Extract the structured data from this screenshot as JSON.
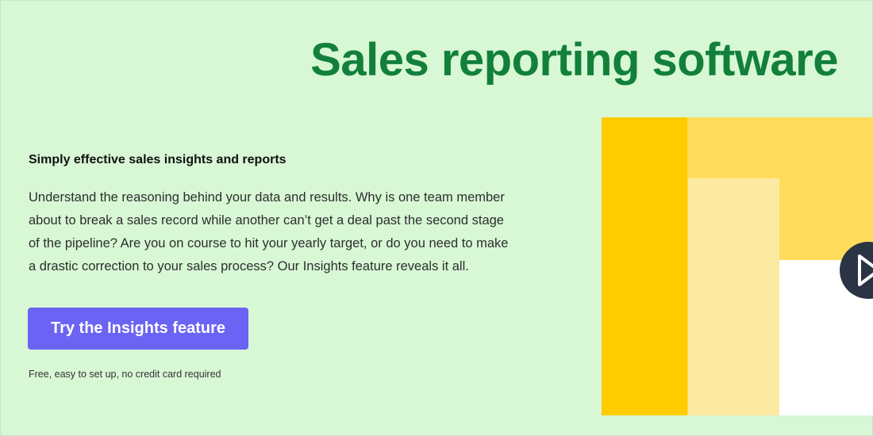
{
  "hero": {
    "title": "Sales reporting software",
    "subtitle": "Simply effective sales insights and reports",
    "body_lines": [
      "Understand the reasoning behind your data and results. Why is one team member",
      "about to break a sales record while another can’t get a deal past the second stage",
      "of the pipeline? Are you on course to hit your yearly target, or do you need to make",
      "a drastic correction to your sales process? Our Insights feature reveals it all."
    ],
    "cta_label": "Try the Insights feature",
    "fineprint": "Free, easy to set up, no credit card required"
  },
  "media": {
    "play_icon": "play-icon"
  },
  "colors": {
    "background": "#d8f7d5",
    "title": "#12803a",
    "cta": "#6b63f3",
    "yellow_dark": "#ffcc00",
    "yellow_mid": "#ffdc5c",
    "yellow_light": "#fdeaa2",
    "play_button": "#2b3445"
  }
}
